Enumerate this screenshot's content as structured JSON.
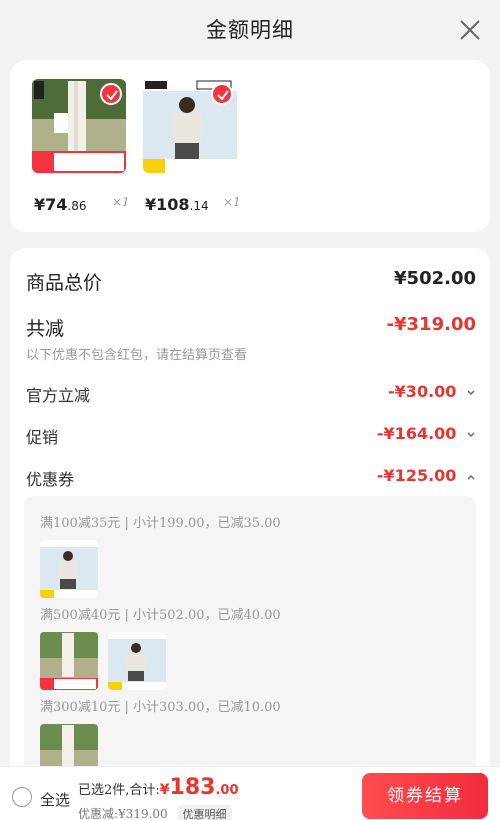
{
  "header": {
    "title": "金额明细"
  },
  "products": [
    {
      "price_int": "¥74",
      "price_dec": ".86",
      "qty": "×1"
    },
    {
      "price_int": "¥108",
      "price_dec": ".14",
      "qty": "×1"
    }
  ],
  "summary": {
    "total_label": "商品总价",
    "total_value": "¥502.00",
    "reduce_label": "共减",
    "reduce_value": "-¥319.00",
    "note": "以下优惠不包含红包，请在结算页查看",
    "official_label": "官方立减",
    "official_value": "-¥30.00",
    "promo_label": "促销",
    "promo_value": "-¥164.00",
    "coupon_label": "优惠券",
    "coupon_value": "-¥125.00"
  },
  "coupon_groups": [
    {
      "title": "满100减35元 | 小计199.00，已减35.00"
    },
    {
      "title": "满500减40元 | 小计502.00，已减40.00"
    },
    {
      "title": "满300减10元 | 小计303.00，已减10.00"
    }
  ],
  "footer": {
    "select_all": "全选",
    "selected_text": "已选2件,合计:",
    "currency": "¥",
    "total_int": "183",
    "total_dec": ".00",
    "discount_text": "优惠减:¥319.00",
    "detail_tag": "优惠明细",
    "checkout": "领券结算"
  },
  "colors": {
    "accent": "#e8352f",
    "checkout": "#f5333f"
  }
}
